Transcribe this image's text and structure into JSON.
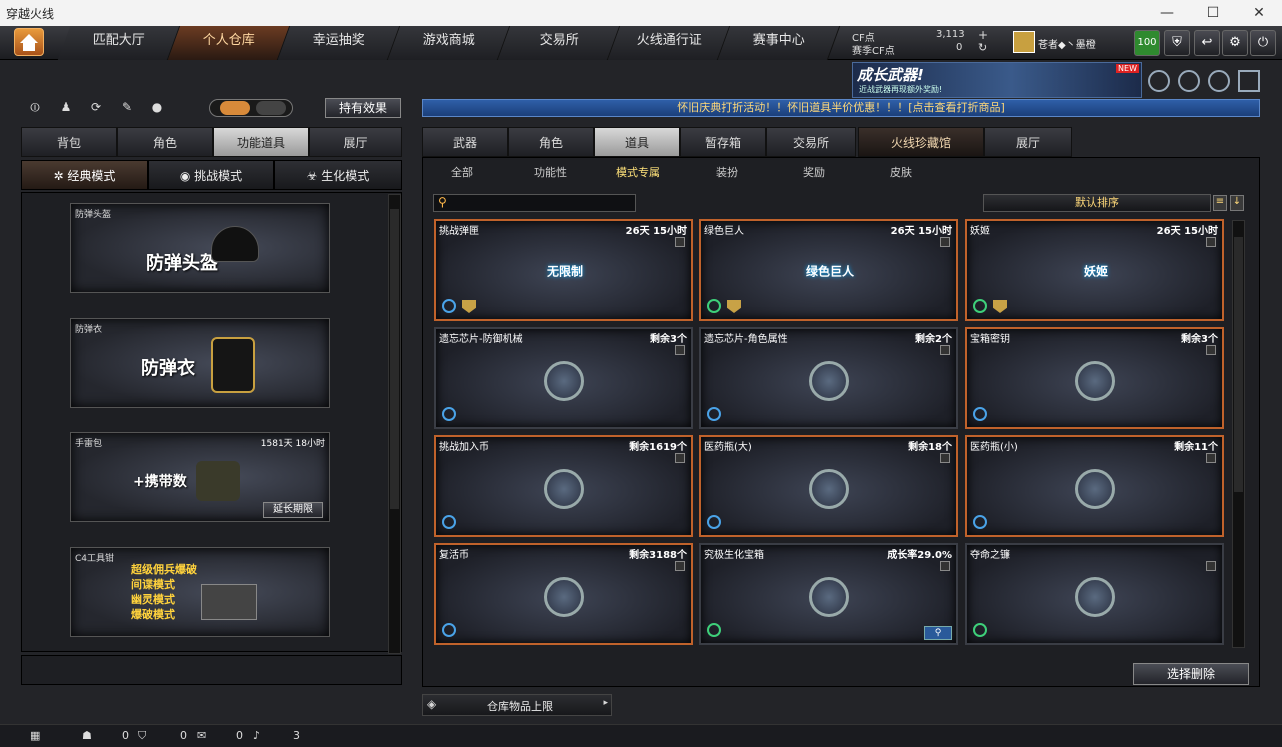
{
  "window": {
    "title": "穿越火线",
    "controls": [
      "—",
      "☐",
      "✕"
    ]
  },
  "nav": {
    "tabs": [
      "匹配大厅",
      "个人仓库",
      "幸运抽奖",
      "游戏商城",
      "交易所",
      "火线通行证",
      "赛事中心"
    ],
    "active": 1
  },
  "currency": {
    "cf_label": "CF点",
    "cf_value": "3,113",
    "season_label": "赛季CF点",
    "season_value": "0"
  },
  "player": {
    "name": "苍者◆丶墨橙",
    "level": "100"
  },
  "banner": {
    "title": "成长武器!",
    "sub": "近战武器再现额外奖励!",
    "badge": "NEW"
  },
  "left": {
    "effect_button": "持有效果",
    "tabs": [
      "背包",
      "角色",
      "功能道具",
      "展厅"
    ],
    "active_tab": 2,
    "modes": [
      "经典模式",
      "挑战模式",
      "生化模式"
    ],
    "active_mode": 0,
    "slots": [
      {
        "label": "防弹头盔",
        "big": "防弹头盔",
        "duration": ""
      },
      {
        "label": "防弹衣",
        "big": "防弹衣",
        "duration": ""
      },
      {
        "label": "手雷包",
        "big": "+携带数",
        "duration": "1581天 18小时",
        "extend": "延长期限"
      },
      {
        "label": "C4工具钳",
        "big": "超级佣兵爆破\n间谍模式\n幽灵模式\n爆破模式",
        "duration": ""
      }
    ]
  },
  "marquee": "怀旧庆典打折活动！！怀旧道具半价优惠！！！[点击查看打折商品]",
  "right": {
    "tabs": [
      "武器",
      "角色",
      "道具",
      "暂存箱",
      "交易所",
      "火线珍藏馆",
      "展厅"
    ],
    "active_tab": 2,
    "subtabs": [
      "全部",
      "功能性",
      "模式专属",
      "装扮",
      "奖励",
      "皮肤"
    ],
    "active_sub": 2,
    "sort": "默认排序",
    "items": [
      {
        "name": "挑战弹匣",
        "status": "26天 15小时",
        "pic": "无限制",
        "icons": [
          "blue",
          "shield"
        ],
        "border": true
      },
      {
        "name": "绿色巨人",
        "status": "26天 15小时",
        "pic": "绿色巨人",
        "icons": [
          "green",
          "shield"
        ],
        "border": true
      },
      {
        "name": "妖姬",
        "status": "26天 15小时",
        "pic": "妖姬",
        "icons": [
          "green",
          "shield"
        ],
        "border": true
      },
      {
        "name": "遗忘芯片-防御机械",
        "status": "剩余3个",
        "pic": "",
        "icons": [
          "blue"
        ],
        "border": false
      },
      {
        "name": "遗忘芯片-角色属性",
        "status": "剩余2个",
        "pic": "",
        "icons": [
          "blue"
        ],
        "border": false
      },
      {
        "name": "宝箱密钥",
        "status": "剩余3个",
        "pic": "",
        "icons": [
          "blue"
        ],
        "border": true
      },
      {
        "name": "挑战加入币",
        "status": "剩余1619个",
        "pic": "",
        "icons": [
          "blue"
        ],
        "border": true
      },
      {
        "name": "医药瓶(大)",
        "status": "剩余18个",
        "pic": "",
        "icons": [
          "blue"
        ],
        "border": true
      },
      {
        "name": "医药瓶(小)",
        "status": "剩余11个",
        "pic": "",
        "icons": [
          "blue"
        ],
        "border": true
      },
      {
        "name": "复活币",
        "status": "剩余3188个",
        "pic": "",
        "icons": [
          "blue"
        ],
        "border": true
      },
      {
        "name": "究极生化宝箱",
        "status": "成长率29.0%",
        "pic": "",
        "icons": [
          "green"
        ],
        "border": false,
        "mag": true
      },
      {
        "name": "夺命之镰",
        "status": "",
        "pic": "",
        "icons": [
          "green"
        ],
        "border": false
      }
    ],
    "delete_button": "选择删除"
  },
  "storage_limit": "仓库物品上限",
  "bottom": {
    "a": "0",
    "b": "0",
    "c": "0",
    "d": "3"
  }
}
